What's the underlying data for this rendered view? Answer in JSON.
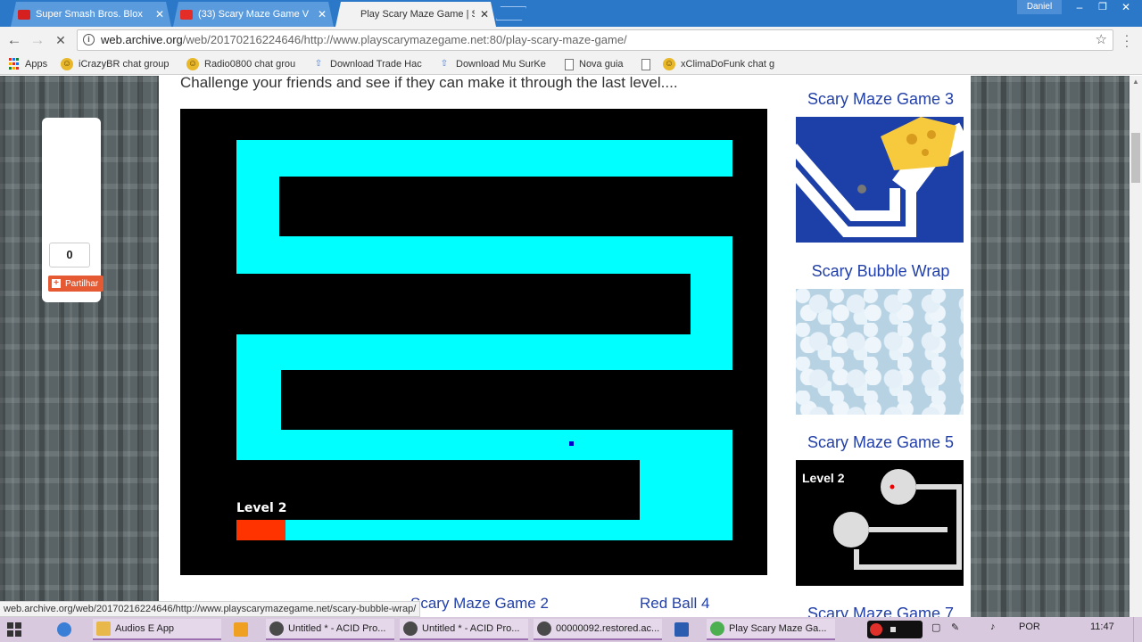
{
  "window": {
    "user": "Daniel",
    "tabs": [
      {
        "title": "Super Smash Bros. Blox",
        "favicon_color": "#d62020",
        "active": false
      },
      {
        "title": "(33) Scary Maze Game V",
        "favicon_color": "#e52d27",
        "active": false
      },
      {
        "title": "Play Scary Maze Game | S",
        "favicon_color": "#5a9bde",
        "active": true
      }
    ],
    "controls": {
      "minimize": "–",
      "restore": "❐",
      "close": "✕"
    }
  },
  "toolbar": {
    "back": "←",
    "forward": "→",
    "reload": "✕",
    "url_host": "web.archive.org",
    "url_rest": "/web/20170216224646/http://www.playscarymazegame.net:80/play-scary-maze-game/",
    "star": "☆"
  },
  "bookmarks": [
    {
      "label": "Apps",
      "icon": "apps-grid-icon"
    },
    {
      "label": "iCrazyBR chat group",
      "icon": "smiley-icon"
    },
    {
      "label": "Radio0800 chat grou",
      "icon": "smiley-icon"
    },
    {
      "label": "Download Trade Hac",
      "icon": "upload-arrow-icon"
    },
    {
      "label": "Download Mu SurKe",
      "icon": "upload-arrow-icon"
    },
    {
      "label": "Nova guia",
      "icon": "page-icon"
    },
    {
      "label": "",
      "icon": "page-icon"
    },
    {
      "label": "xClimaDoFunk chat g",
      "icon": "smiley-icon"
    }
  ],
  "share": {
    "count": "0",
    "button": "Partilhar"
  },
  "page": {
    "intro": "Challenge your friends and see if they can make it through the last level....",
    "game_level": "Level 2",
    "bottom_links": [
      "Scary Maze Game 2",
      "Red Ball 4"
    ],
    "sidebar": [
      {
        "title": "Scary Maze Game 3"
      },
      {
        "title": "Scary Bubble Wrap"
      },
      {
        "title": "Scary Maze Game 5",
        "thumb_text": "Level 2"
      },
      {
        "title": "Scary Maze Game 7"
      }
    ]
  },
  "status_url": "web.archive.org/web/20170216224646/http://www.playscarymazegame.net/scary-bubble-wrap/",
  "taskbar": {
    "items": [
      {
        "label": "Audios E App",
        "icon_color": "#e8b84a"
      },
      {
        "label": "",
        "icon_color": "#f0a020"
      },
      {
        "label": "Untitled * - ACID Pro...",
        "icon_color": "#4a4a4a"
      },
      {
        "label": "Untitled * - ACID Pro...",
        "icon_color": "#4a4a4a"
      },
      {
        "label": "00000092.restored.ac...",
        "icon_color": "#4a4a4a"
      },
      {
        "label": "",
        "icon_color": "#2a5db0"
      },
      {
        "label": "Play Scary Maze Ga...",
        "icon_color": "#4caf50"
      }
    ],
    "language": "POR",
    "time": "11:47"
  },
  "colors": {
    "chrome_blue": "#2b78c9",
    "maze_path": "#00ffff",
    "maze_wall": "#000000",
    "start_block": "#ff3300",
    "link_blue": "#2240a8",
    "share_orange": "#e55a32",
    "taskbar": "#d8c9de"
  }
}
